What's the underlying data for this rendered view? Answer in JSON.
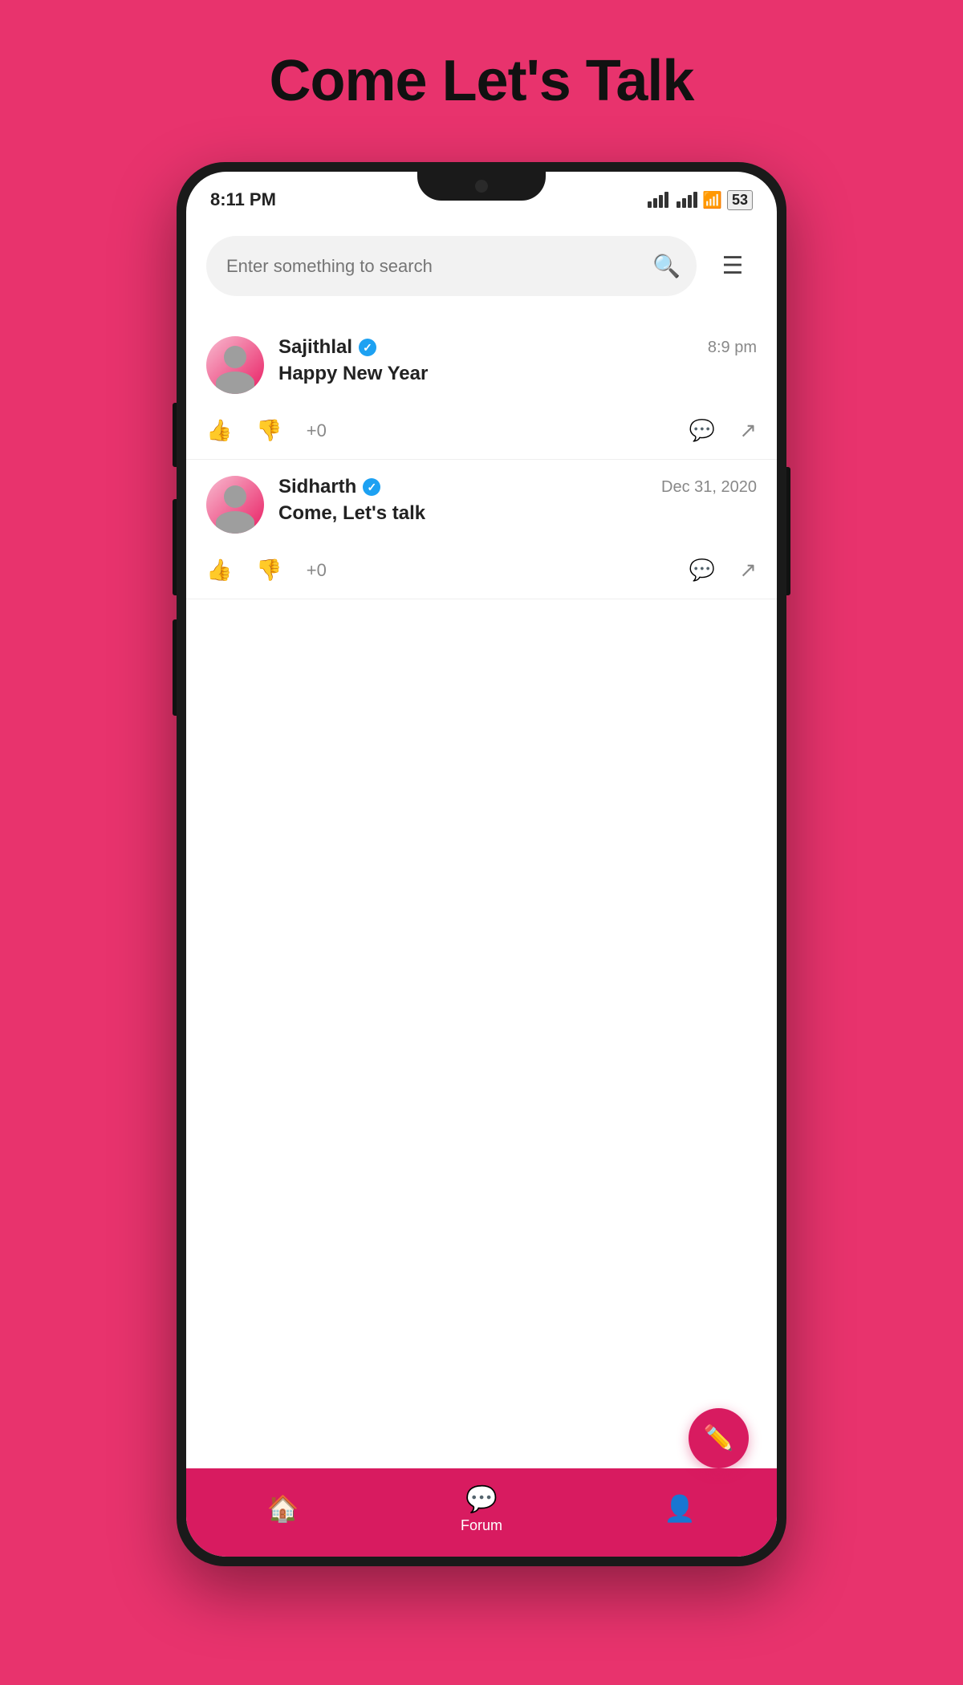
{
  "page": {
    "title": "Come Let's Talk",
    "background_color": "#E8336D"
  },
  "status_bar": {
    "time": "8:11 PM",
    "battery": "53"
  },
  "search": {
    "placeholder": "Enter something to search"
  },
  "posts": [
    {
      "id": "post-1",
      "author": "Sajithlal",
      "verified": true,
      "time": "8:9 pm",
      "content": "Happy New Year",
      "score": "+0"
    },
    {
      "id": "post-2",
      "author": "Sidharth",
      "verified": true,
      "time": "Dec 31, 2020",
      "content": "Come, Let's talk",
      "score": "+0"
    }
  ],
  "bottom_nav": {
    "items": [
      {
        "label": "Home",
        "icon": "🏠"
      },
      {
        "label": "Forum",
        "icon": "💬"
      },
      {
        "label": "Profile",
        "icon": "👤"
      }
    ]
  },
  "fab": {
    "icon": "✏️"
  }
}
